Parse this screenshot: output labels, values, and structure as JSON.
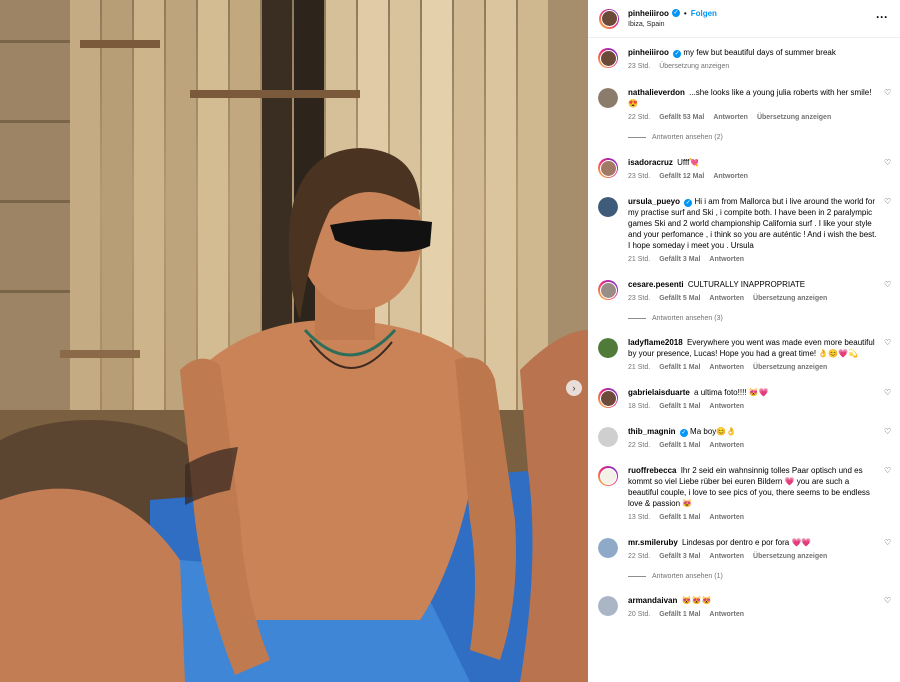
{
  "post": {
    "author": "pinheiiiroo",
    "follow_label": "Folgen",
    "location": "Ibiza, Spain",
    "more_icon": "more-horizontal-icon"
  },
  "caption": {
    "username": "pinheiiiroo",
    "text": "my few but beautiful days of summer break",
    "time": "23 Std.",
    "translate": "Übersetzung anzeigen"
  },
  "comments": [
    {
      "username": "nathalieverdon",
      "text": "...she looks like a young julia roberts with her smile! 😍",
      "time": "22 Std.",
      "likes": "Gefällt 53 Mal",
      "reply": "Antworten",
      "translate": "Übersetzung anzeigen",
      "replies": "Antworten ansehen (2)"
    },
    {
      "username": "isadoracruz",
      "text": "Ufff💘",
      "time": "23 Std.",
      "likes": "Gefällt 12 Mal",
      "reply": "Antworten"
    },
    {
      "username": "ursula_pueyo",
      "text": "Hi i am from Mallorca but i live around the world for my practise surf and Ski , i compite both. I have been in 2 paralympic games Ski and 2 world championship California surf . I like your style and your perfomance , i think so you are auténtic ! And i wish the best. I hope someday i meet you . Ursula",
      "time": "21 Std.",
      "likes": "Gefällt 3 Mal",
      "reply": "Antworten"
    },
    {
      "username": "cesare.pesenti",
      "text": "CULTURALLY INAPPROPRIATE",
      "time": "23 Std.",
      "likes": "Gefällt 5 Mal",
      "reply": "Antworten",
      "translate": "Übersetzung anzeigen",
      "replies": "Antworten ansehen (3)"
    },
    {
      "username": "ladyflame2018",
      "text": "Everywhere you went was made even more beautiful by your presence, Lucas! Hope you had a great time! 👌😊💗💫",
      "time": "21 Std.",
      "likes": "Gefällt 1 Mal",
      "reply": "Antworten",
      "translate": "Übersetzung anzeigen"
    },
    {
      "username": "gabrielaisduarte",
      "text": "a ultima foto!!!! 😻💗",
      "time": "18 Std.",
      "likes": "Gefällt 1 Mal",
      "reply": "Antworten"
    },
    {
      "username": "thib_magnin",
      "text": "Ma boy😊👌",
      "time": "22 Std.",
      "likes": "Gefällt 1 Mal",
      "reply": "Antworten"
    },
    {
      "username": "ruoffrebecca",
      "text": "Ihr 2 seid ein wahnsinnig tolles Paar optisch und es kommt so viel Liebe rüber bei euren Bildern 💗 you are such a beautiful couple, i love to see pics of you, there seems to be endless love & passion 😻",
      "time": "13 Std.",
      "likes": "Gefällt 1 Mal",
      "reply": "Antworten"
    },
    {
      "username": "mr.smileruby",
      "text": "Lindesas por dentro e por fora 💗💗",
      "time": "22 Std.",
      "likes": "Gefällt 3 Mal",
      "reply": "Antworten",
      "translate": "Übersetzung anzeigen",
      "replies": "Antworten ansehen (1)"
    },
    {
      "username": "armandaivan",
      "text": "😻😻😻",
      "time": "20 Std.",
      "likes": "Gefällt 1 Mal",
      "reply": "Antworten"
    }
  ],
  "colors": {
    "link": "#0095f6",
    "muted": "#737373",
    "verified": "#0095f6"
  }
}
